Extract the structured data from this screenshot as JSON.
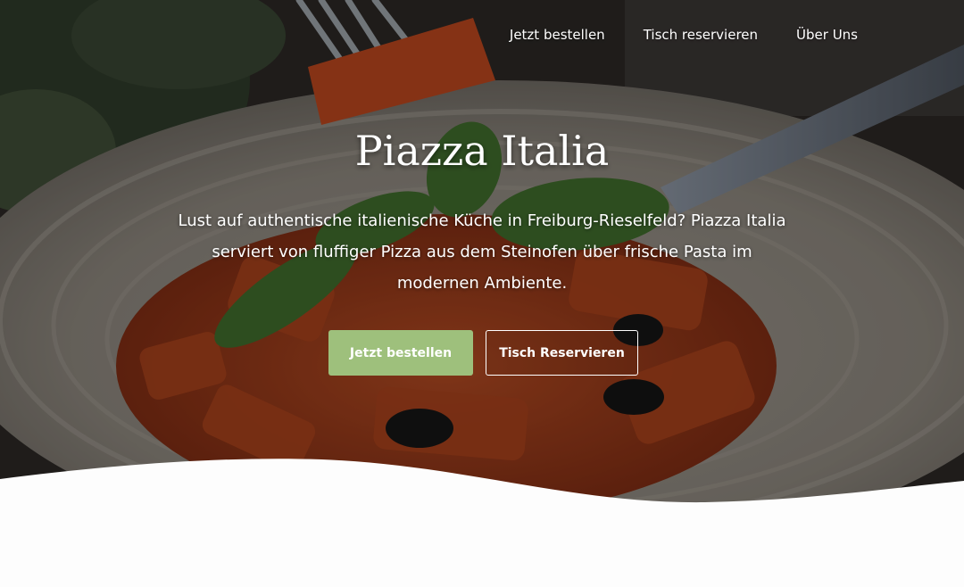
{
  "nav": {
    "items": [
      "Jetzt bestellen",
      "Tisch reservieren",
      "Über Uns"
    ]
  },
  "hero": {
    "title": "Piazza Italia",
    "lead_lines": [
      "Lust auf authentische italienische Küche in Freiburg-Rieselfeld? Piazza Italia",
      "serviert von fluffiger Pizza aus dem Steinofen über frische Pasta im",
      "modernen Ambiente."
    ],
    "primary_button": "Jetzt bestellen",
    "secondary_button": "Tisch Reservieren",
    "image": "pasta-dish-photo"
  },
  "colors": {
    "accent": "#9ec07c",
    "text_light": "#ffffff",
    "page_bg": "#fdfdfd"
  }
}
